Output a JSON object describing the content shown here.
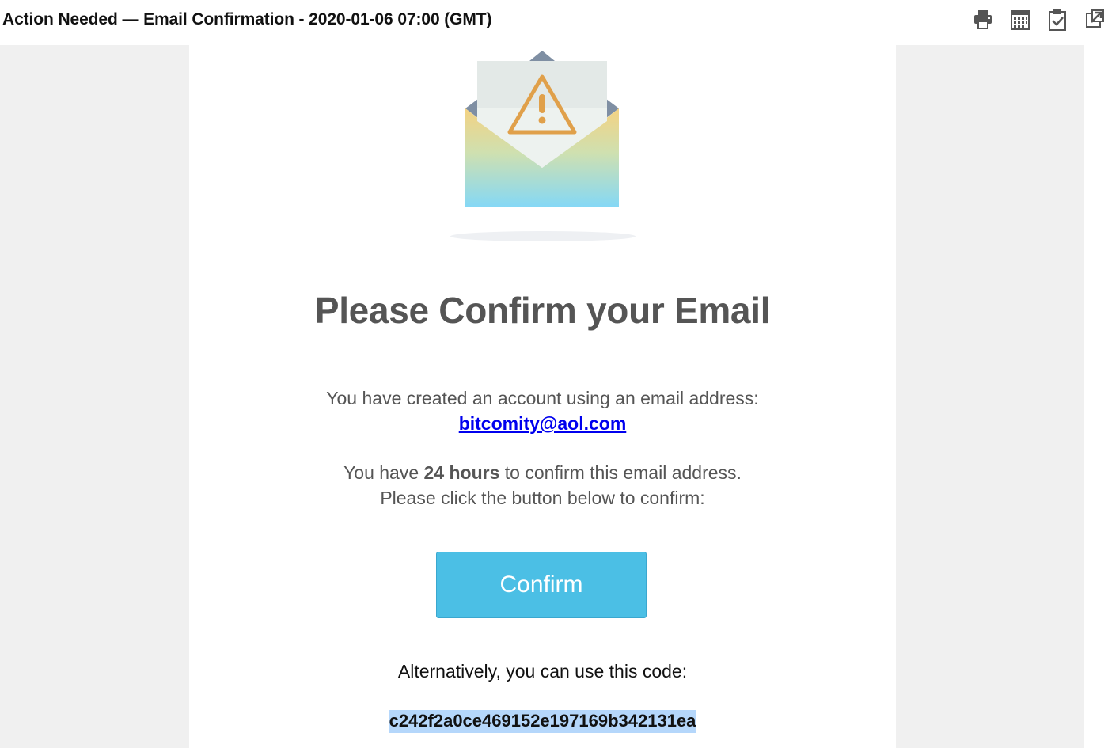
{
  "header": {
    "subject": "Action Needed — Email Confirmation - 2020-01-06 07:00 (GMT)",
    "icons": [
      "print-icon",
      "calendar-icon",
      "clipboard-check-icon",
      "open-external-icon"
    ]
  },
  "email": {
    "headline": "Please Confirm your Email",
    "account_text": "You have created an account using an email address:",
    "email_address": "bitcomity@aol.com",
    "deadline_prefix": "You have ",
    "deadline_bold": "24 hours",
    "deadline_suffix": " to confirm this email address.",
    "click_instruction": "Please click the button below to confirm:",
    "confirm_button": "Confirm",
    "alt_text": "Alternatively, you can use this code:",
    "code": "c242f2a0ce469152e197169b342131ea"
  },
  "colors": {
    "button": "#4bbfe5",
    "link": "#0000ee",
    "warning": "#e0a04a",
    "code_highlight": "#b5d7fb"
  }
}
